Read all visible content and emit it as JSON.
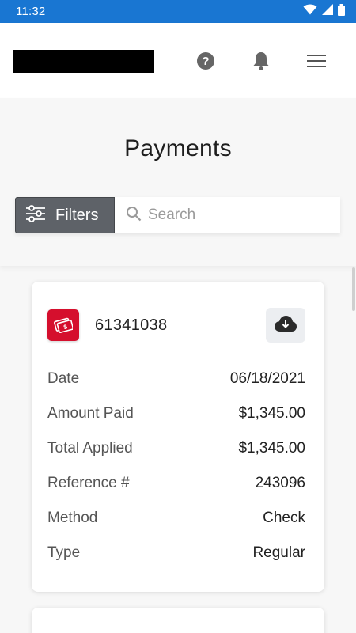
{
  "status_bar": {
    "time": "11:32",
    "icons": [
      "wifi-icon",
      "cellular-signal-icon",
      "battery-icon"
    ]
  },
  "app_bar": {
    "icons": [
      "help-icon",
      "bell-icon",
      "menu-icon"
    ]
  },
  "page": {
    "title": "Payments"
  },
  "toolbar": {
    "filters_label": "Filters",
    "search_placeholder": "Search"
  },
  "payment": {
    "number": "61341038",
    "icon": "payment-check-icon",
    "accent": "#d50f2d",
    "rows": [
      {
        "label": "Date",
        "value": "06/18/2021"
      },
      {
        "label": "Amount Paid",
        "value": "$1,345.00"
      },
      {
        "label": "Total Applied",
        "value": "$1,345.00"
      },
      {
        "label": "Reference #",
        "value": "243096"
      },
      {
        "label": "Method",
        "value": "Check"
      },
      {
        "label": "Type",
        "value": "Regular"
      }
    ]
  },
  "colors": {
    "status_bar": "#1976d2",
    "filter_button": "#5e6268",
    "payment_icon": "#d50f2d"
  }
}
